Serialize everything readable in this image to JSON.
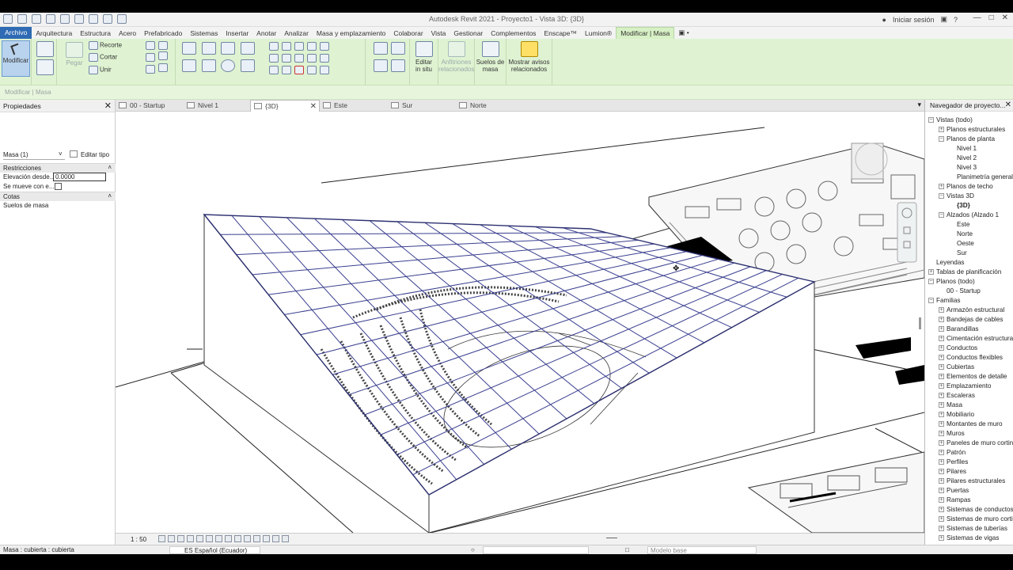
{
  "window": {
    "title": "Autodesk Revit 2021 - Proyecto1 - Vista 3D: {3D}",
    "signin": "Iniciar sesión"
  },
  "menu": {
    "tabs": [
      "Archivo",
      "Arquitectura",
      "Estructura",
      "Acero",
      "Prefabricado",
      "Sistemas",
      "Insertar",
      "Anotar",
      "Analizar",
      "Masa y emplazamiento",
      "Colaborar",
      "Vista",
      "Gestionar",
      "Complementos",
      "Enscape™",
      "Lumion®",
      "Modificar | Masa"
    ],
    "active_index": 16
  },
  "ribbon": {
    "modify": "Modificar",
    "paste": "Pegar",
    "cut": "Recorte",
    "cope": "Cortar",
    "join": "Unir",
    "edit_in_place": [
      "Editar",
      "in situ"
    ],
    "hosts": [
      "Anfitriones",
      "relacionados"
    ],
    "mass_floors": [
      "Suelos de",
      "masa"
    ],
    "warnings": [
      "Mostrar avisos",
      "relacionados"
    ]
  },
  "context_bar": "Modificar | Masa",
  "properties": {
    "title": "Propiedades",
    "type_selector": "Masa (1)",
    "edit_type": "Editar tipo",
    "section_constraints": "Restricciones",
    "elevation_label": "Elevación desde...",
    "elevation_value": "0.0000",
    "moves_with_label": "Se mueve con e...",
    "section_notes": "Cotas",
    "mass_floors_label": "Suelos de masa"
  },
  "doc_tabs": [
    {
      "label": "00 - Startup",
      "closable": false
    },
    {
      "label": "Nivel 1",
      "closable": false
    },
    {
      "label": "{3D}",
      "closable": true
    },
    {
      "label": "Este",
      "closable": false
    },
    {
      "label": "Sur",
      "closable": false
    },
    {
      "label": "Norte",
      "closable": false
    }
  ],
  "view_bar": {
    "scale": "1 : 50"
  },
  "browser": {
    "title": "Navegador de proyecto...",
    "items": [
      {
        "label": "Vistas (todo)",
        "level": 0,
        "toggle": "-"
      },
      {
        "label": "Planos estructurales",
        "level": 1,
        "toggle": "+"
      },
      {
        "label": "Planos de planta",
        "level": 1,
        "toggle": "-"
      },
      {
        "label": "Nivel 1",
        "level": 2,
        "toggle": ""
      },
      {
        "label": "Nivel 2",
        "level": 2,
        "toggle": ""
      },
      {
        "label": "Nivel 3",
        "level": 2,
        "toggle": ""
      },
      {
        "label": "Planimetría general",
        "level": 2,
        "toggle": ""
      },
      {
        "label": "Planos de techo",
        "level": 1,
        "toggle": "+"
      },
      {
        "label": "Vistas 3D",
        "level": 1,
        "toggle": "-"
      },
      {
        "label": "{3D}",
        "level": 2,
        "toggle": "",
        "bold": true
      },
      {
        "label": "Alzados (Alzado 1",
        "level": 1,
        "toggle": "-"
      },
      {
        "label": "Este",
        "level": 2,
        "toggle": ""
      },
      {
        "label": "Norte",
        "level": 2,
        "toggle": ""
      },
      {
        "label": "Oeste",
        "level": 2,
        "toggle": ""
      },
      {
        "label": "Sur",
        "level": 2,
        "toggle": ""
      },
      {
        "label": "Leyendas",
        "level": 0,
        "toggle": ""
      },
      {
        "label": "Tablas de planificación",
        "level": 0,
        "toggle": "+"
      },
      {
        "label": "Planos (todo)",
        "level": 0,
        "toggle": "-"
      },
      {
        "label": "00 - Startup",
        "level": 1,
        "toggle": ""
      },
      {
        "label": "Familias",
        "level": 0,
        "toggle": "-"
      },
      {
        "label": "Armazón estructural",
        "level": 1,
        "toggle": "+"
      },
      {
        "label": "Bandejas de cables",
        "level": 1,
        "toggle": "+"
      },
      {
        "label": "Barandillas",
        "level": 1,
        "toggle": "+"
      },
      {
        "label": "Cimentación estructural",
        "level": 1,
        "toggle": "+"
      },
      {
        "label": "Conductos",
        "level": 1,
        "toggle": "+"
      },
      {
        "label": "Conductos flexibles",
        "level": 1,
        "toggle": "+"
      },
      {
        "label": "Cubiertas",
        "level": 1,
        "toggle": "+"
      },
      {
        "label": "Elementos de detalle",
        "level": 1,
        "toggle": "+"
      },
      {
        "label": "Emplazamiento",
        "level": 1,
        "toggle": "+"
      },
      {
        "label": "Escaleras",
        "level": 1,
        "toggle": "+"
      },
      {
        "label": "Masa",
        "level": 1,
        "toggle": "+"
      },
      {
        "label": "Mobiliario",
        "level": 1,
        "toggle": "+"
      },
      {
        "label": "Montantes de muro",
        "level": 1,
        "toggle": "+"
      },
      {
        "label": "Muros",
        "level": 1,
        "toggle": "+"
      },
      {
        "label": "Paneles de muro cortina",
        "level": 1,
        "toggle": "+"
      },
      {
        "label": "Patrón",
        "level": 1,
        "toggle": "+"
      },
      {
        "label": "Perfiles",
        "level": 1,
        "toggle": "+"
      },
      {
        "label": "Pilares",
        "level": 1,
        "toggle": "+"
      },
      {
        "label": "Pilares estructurales",
        "level": 1,
        "toggle": "+"
      },
      {
        "label": "Puertas",
        "level": 1,
        "toggle": "+"
      },
      {
        "label": "Rampas",
        "level": 1,
        "toggle": "+"
      },
      {
        "label": "Sistemas de conductos",
        "level": 1,
        "toggle": "+"
      },
      {
        "label": "Sistemas de muro cortina",
        "level": 1,
        "toggle": "+"
      },
      {
        "label": "Sistemas de tuberías",
        "level": 1,
        "toggle": "+"
      },
      {
        "label": "Sistemas de vigas",
        "level": 1,
        "toggle": "+"
      }
    ]
  },
  "status": {
    "selection": "Masa : cubierta : cubierta",
    "language": "ES Español (Ecuador)",
    "model": "Modelo base"
  },
  "colors": {
    "ribbon": "#dff3d2",
    "file_tab": "#2e6bb4",
    "grid": "#3a3f8f"
  }
}
